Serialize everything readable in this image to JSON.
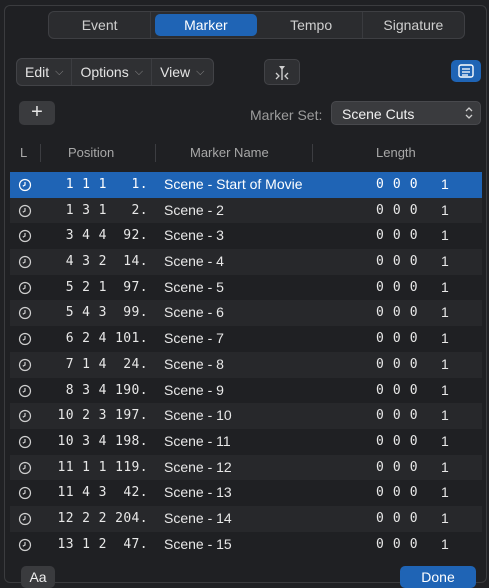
{
  "tabs": [
    {
      "label": "Event",
      "active": false
    },
    {
      "label": "Marker",
      "active": true
    },
    {
      "label": "Tempo",
      "active": false
    },
    {
      "label": "Signature",
      "active": false
    }
  ],
  "toolbar": {
    "edit_label": "Edit",
    "options_label": "Options",
    "view_label": "View",
    "catch_icon": "catch-playhead-icon",
    "list_icon": "list-view-icon"
  },
  "marker_set": {
    "add_label": "+",
    "label": "Marker Set:",
    "value": "Scene Cuts"
  },
  "columns": {
    "l": "L",
    "position": "Position",
    "name": "Marker Name",
    "length": "Length"
  },
  "rows": [
    {
      "position": "1 1 1   1.",
      "name": "Scene - Start of Movie",
      "length": "0 0 0",
      "length2": "1"
    },
    {
      "position": "1 3 1   2.",
      "name": "Scene - 2",
      "length": "0 0 0",
      "length2": "1"
    },
    {
      "position": "3 4 4  92.",
      "name": "Scene - 3",
      "length": "0 0 0",
      "length2": "1"
    },
    {
      "position": "4 3 2  14.",
      "name": "Scene - 4",
      "length": "0 0 0",
      "length2": "1"
    },
    {
      "position": "5 2 1  97.",
      "name": "Scene - 5",
      "length": "0 0 0",
      "length2": "1"
    },
    {
      "position": "5 4 3  99.",
      "name": "Scene - 6",
      "length": "0 0 0",
      "length2": "1"
    },
    {
      "position": "6 2 4 101.",
      "name": "Scene - 7",
      "length": "0 0 0",
      "length2": "1"
    },
    {
      "position": "7 1 4  24.",
      "name": "Scene - 8",
      "length": "0 0 0",
      "length2": "1"
    },
    {
      "position": "8 3 4 190.",
      "name": "Scene - 9",
      "length": "0 0 0",
      "length2": "1"
    },
    {
      "position": "10 2 3 197.",
      "name": "Scene - 10",
      "length": "0 0 0",
      "length2": "1"
    },
    {
      "position": "10 3 4 198.",
      "name": "Scene - 11",
      "length": "0 0 0",
      "length2": "1"
    },
    {
      "position": "11 1 1 119.",
      "name": "Scene - 12",
      "length": "0 0 0",
      "length2": "1"
    },
    {
      "position": "11 4 3  42.",
      "name": "Scene - 13",
      "length": "0 0 0",
      "length2": "1"
    },
    {
      "position": "12 2 2 204.",
      "name": "Scene - 14",
      "length": "0 0 0",
      "length2": "1"
    },
    {
      "position": "13 1 2  47.",
      "name": "Scene - 15",
      "length": "0 0 0",
      "length2": "1"
    }
  ],
  "bottom": {
    "aa_label": "Aa",
    "done_label": "Done"
  },
  "colors": {
    "accent": "#1f64b5",
    "background": "#1f2023"
  }
}
